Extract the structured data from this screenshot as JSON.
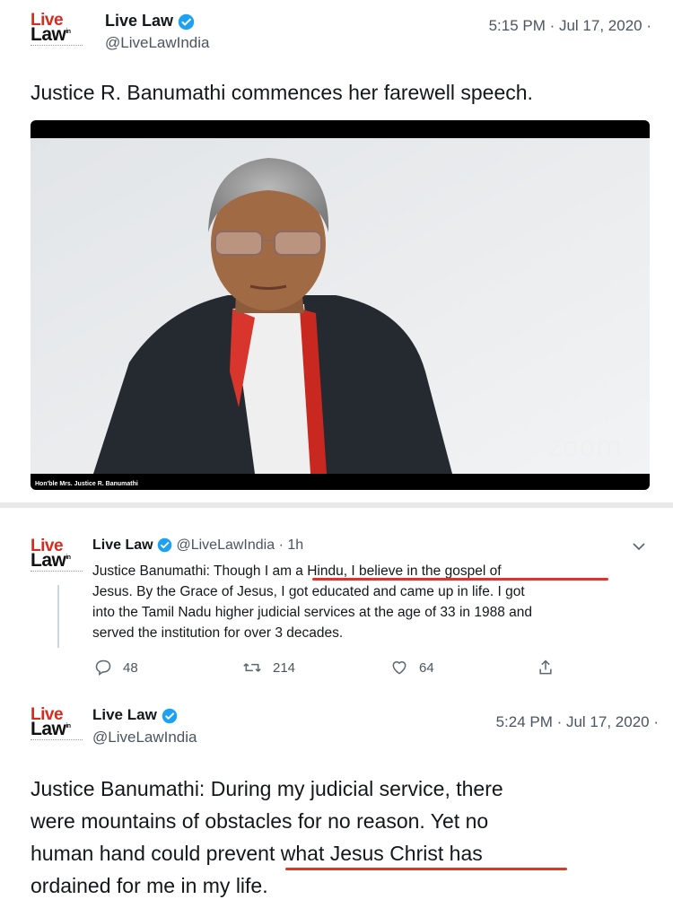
{
  "tweet1": {
    "logo": {
      "line1": "Live",
      "line2": "Law",
      "sup": "in"
    },
    "name": "Live Law",
    "handle": "@LiveLawIndia",
    "time": "5:15 PM · Jul 17, 2020 ·",
    "text": "Justice R. Banumathi commences her farewell speech.",
    "video": {
      "caption": "Hon'ble Mrs. Justice R. Banumathi",
      "watermark": "zoom"
    }
  },
  "tweet2": {
    "logo": {
      "line1": "Live",
      "line2": "Law",
      "sup": "in"
    },
    "name": "Live Law",
    "handle": "@LiveLawIndia · 1h",
    "lines": [
      "Justice Banumathi: Though I am a Hindu, I believe in the gospel of",
      "Jesus. By the Grace of Jesus, I got educated and came up in life. I got",
      "into the Tamil Nadu higher judicial services at the age of 33 in 1988 and",
      "served the institution for over 3 decades."
    ],
    "actions": {
      "replies": "48",
      "retweets": "214",
      "likes": "64"
    },
    "icons": [
      "reply-icon",
      "retweet-icon",
      "like-icon",
      "share-icon",
      "chevron-down-icon"
    ]
  },
  "tweet3": {
    "logo": {
      "line1": "Live",
      "line2": "Law",
      "sup": "in"
    },
    "name": "Live Law",
    "handle": "@LiveLawIndia",
    "time": "5:24 PM · Jul 17, 2020 ·",
    "lines": [
      "Justice Banumathi: During my judicial service, there",
      "were mountains of obstacles for no reason. Yet no",
      "human hand could prevent what Jesus Christ has",
      "ordained for me in my life."
    ]
  },
  "colors": {
    "verified": "#1da1f2",
    "underline": "#e0342a",
    "brand_red": "#d92a20"
  }
}
